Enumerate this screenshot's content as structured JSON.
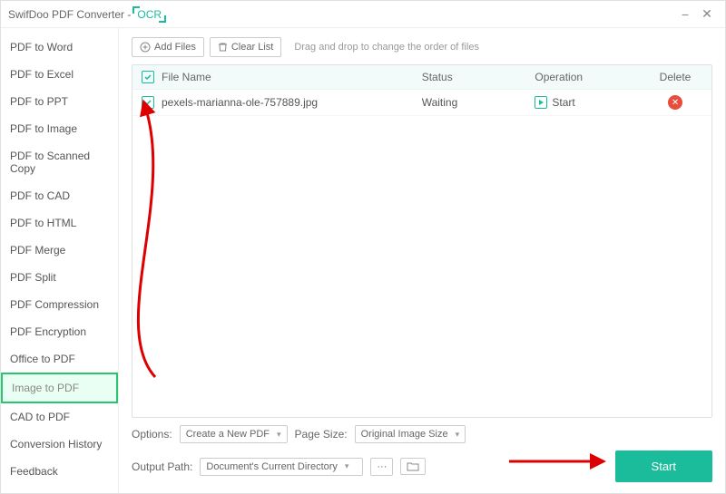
{
  "titlebar": {
    "title": "SwifDoo PDF Converter - ",
    "ocr": "OCR"
  },
  "sidebar": {
    "items": [
      {
        "label": "PDF to Word"
      },
      {
        "label": "PDF to Excel"
      },
      {
        "label": "PDF to PPT"
      },
      {
        "label": "PDF to Image"
      },
      {
        "label": "PDF to Scanned Copy"
      },
      {
        "label": "PDF to CAD"
      },
      {
        "label": "PDF to HTML"
      },
      {
        "label": "PDF Merge"
      },
      {
        "label": "PDF Split"
      },
      {
        "label": "PDF Compression"
      },
      {
        "label": "PDF Encryption"
      },
      {
        "label": "Office to PDF"
      },
      {
        "label": "Image to PDF"
      },
      {
        "label": "CAD to PDF"
      },
      {
        "label": "Conversion History"
      },
      {
        "label": "Feedback"
      }
    ],
    "active_index": 12
  },
  "toolbar": {
    "add_files": "Add Files",
    "clear_list": "Clear List",
    "hint": "Drag and drop to change the order of files"
  },
  "table": {
    "headers": {
      "name": "File Name",
      "status": "Status",
      "operation": "Operation",
      "delete": "Delete"
    },
    "rows": [
      {
        "name": "pexels-marianna-ole-757889.jpg",
        "status": "Waiting",
        "op": "Start"
      }
    ]
  },
  "options": {
    "label": "Options:",
    "select_value": "Create a New PDF",
    "pagesize_label": "Page Size:",
    "pagesize_value": "Original Image Size"
  },
  "output": {
    "label": "Output Path:",
    "value": "Document's Current Directory",
    "browse": "···"
  },
  "start_button": "Start"
}
